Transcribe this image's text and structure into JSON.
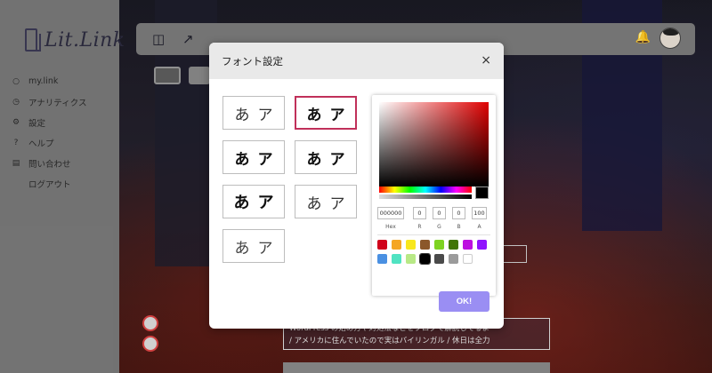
{
  "app": {
    "logo_text": "Lit.Link"
  },
  "sidebar": {
    "items": [
      {
        "label": "my.link",
        "icon": "user-icon"
      },
      {
        "label": "アナリティクス",
        "icon": "clock-icon"
      },
      {
        "label": "設定",
        "icon": "gear-icon"
      },
      {
        "label": "ヘルプ",
        "icon": "question-icon"
      },
      {
        "label": "問い合わせ",
        "icon": "message-icon"
      },
      {
        "label": "ログアウト",
        "icon": ""
      }
    ]
  },
  "background": {
    "banner_line1": "WordPress の始め方や対処法などをブログで解説してるよ",
    "banner_line2": "/ アメリカに住んでいたので実はバイリンガル / 休日は全力"
  },
  "modal": {
    "title": "フォント設定",
    "close_label": "×",
    "font_options": [
      {
        "sample": "あア",
        "style": "regular-sans",
        "selected": false
      },
      {
        "sample": "あア",
        "style": "bold-sans",
        "selected": true
      },
      {
        "sample": "あア",
        "style": "medium-sans",
        "selected": false
      },
      {
        "sample": "あア",
        "style": "bold-rounded",
        "selected": false
      },
      {
        "sample": "あア",
        "style": "black-sans",
        "selected": false
      },
      {
        "sample": "あア",
        "style": "light-sans",
        "selected": false
      },
      {
        "sample": "あア",
        "style": "thin-sans",
        "selected": false
      }
    ],
    "color_picker": {
      "hex": "000000",
      "r": "0",
      "g": "0",
      "b": "0",
      "a": "100",
      "labels": {
        "hex": "Hex",
        "r": "R",
        "g": "G",
        "b": "B",
        "a": "A"
      },
      "swatches": [
        "#d0021b",
        "#f5a623",
        "#f8e71c",
        "#8b572a",
        "#7ed321",
        "#417505",
        "#bd10e0",
        "#9013fe",
        "#4a90e2",
        "#50e3c2",
        "#b8e986",
        "#000000",
        "#4a4a4a",
        "#9b9b9b",
        "#ffffff"
      ],
      "selected_swatch": "#000000"
    },
    "ok_label": "OK!"
  },
  "colors": {
    "accent": "#9a8ef3",
    "selected_border": "#c0305a"
  }
}
